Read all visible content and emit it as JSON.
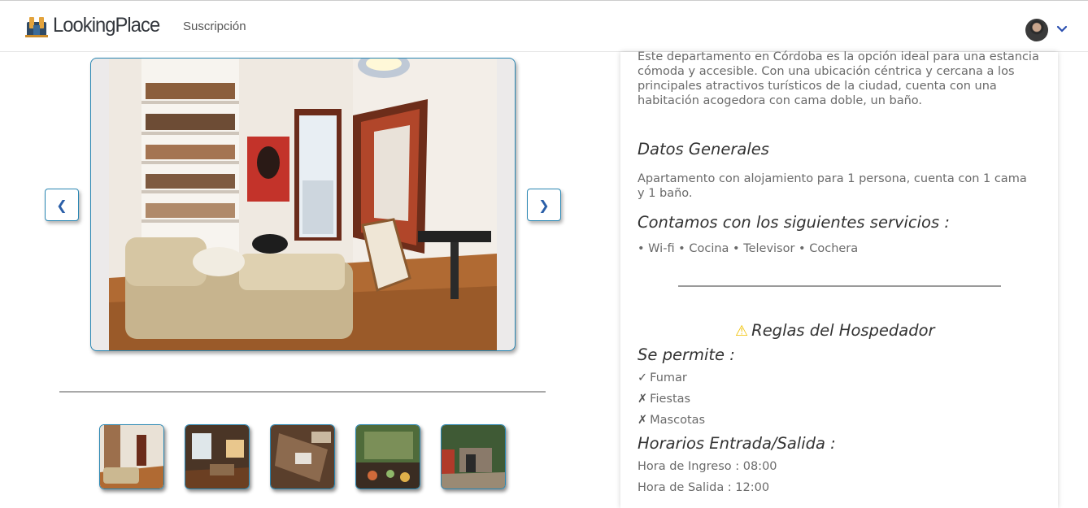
{
  "header": {
    "logo_text": "LookingPlace",
    "nav": {
      "subscription": "Suscripción"
    }
  },
  "carousel": {
    "prev_label": "❮",
    "next_label": "❯",
    "thumbnails_count": 5
  },
  "details": {
    "description": "Este departamento en Córdoba es la opción ideal para una estancia cómoda y accesible. Con una ubicación céntrica y cercana a los principales atractivos turísticos de la ciudad, cuenta con una habitación acogedora con cama doble, un baño.",
    "general_title": "Datos Generales",
    "general_text": "Apartamento con alojamiento para 1 persona, cuenta con 1 cama y 1 baño.",
    "services_title": "Contamos con los siguientes servicios :",
    "services": "• Wi-fi • Cocina • Televisor • Cochera",
    "rules_title": "Reglas del Hospedador",
    "allowed_title": "Se permite :",
    "rules": [
      {
        "mark": "✓",
        "label": "Fumar"
      },
      {
        "mark": "✗",
        "label": "Fiestas"
      },
      {
        "mark": "✗",
        "label": "Mascotas"
      }
    ],
    "schedule_title": "Horarios Entrada/Salida :",
    "check_in": "Hora de Ingreso : 08:00",
    "check_out": "Hora de Salida : 12:00"
  },
  "colors": {
    "accent": "#2b87b3",
    "arrow": "#2b5fa8",
    "warning": "#f0c000"
  }
}
